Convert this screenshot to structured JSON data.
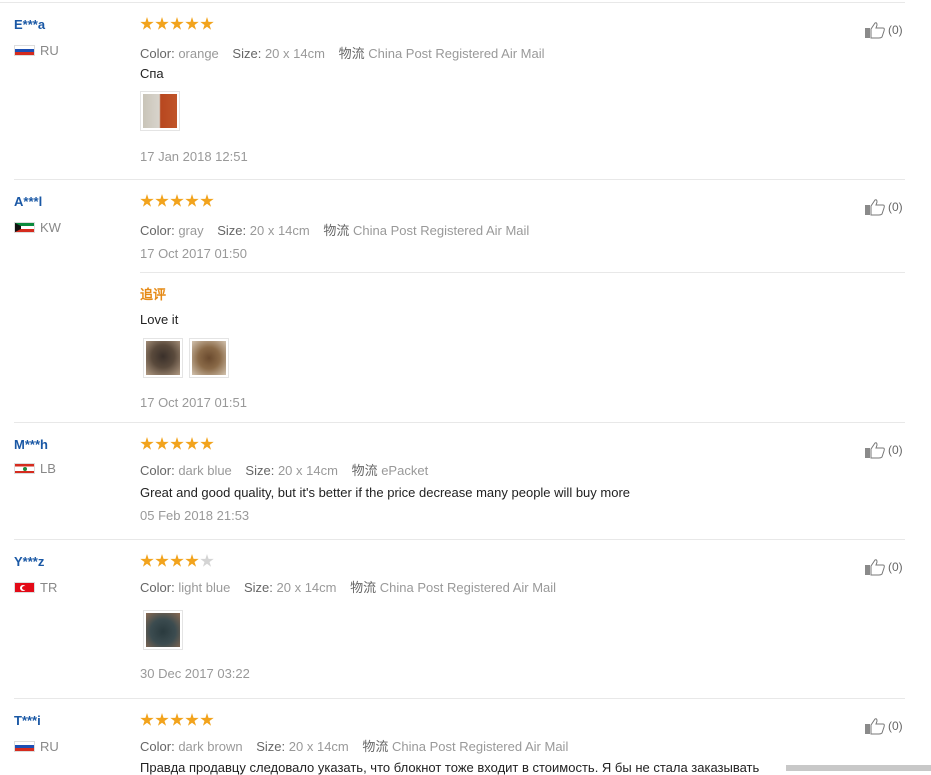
{
  "labels": {
    "color": "Color:",
    "size": "Size:",
    "shipping": "物流"
  },
  "reviews": [
    {
      "user": "E***a",
      "country": "RU",
      "rating": 5,
      "color": "orange",
      "size": "20 x 14cm",
      "shipping": "China Post Registered Air Mail",
      "text": "Спа",
      "images": [
        "photo-notebook-orange"
      ],
      "date": "17 Jan 2018 12:51",
      "likes": "(0)"
    },
    {
      "user": "A***l",
      "country": "KW",
      "rating": 5,
      "color": "gray",
      "size": "20 x 14cm",
      "shipping": "China Post Registered Air Mail",
      "text": "",
      "images": [],
      "date": "17 Oct 2017 01:50",
      "likes": "(0)",
      "followup": {
        "title": "追评",
        "text": "Love it",
        "images": [
          "photo-notebook-gray-1",
          "photo-notebook-gray-2"
        ],
        "date": "17 Oct 2017 01:51"
      }
    },
    {
      "user": "M***h",
      "country": "LB",
      "rating": 5,
      "color": "dark blue",
      "size": "20 x 14cm",
      "shipping": "ePacket",
      "text": "Great and good quality, but it's better if the price decrease many people will buy more",
      "images": [],
      "date": "05 Feb 2018 21:53",
      "likes": "(0)"
    },
    {
      "user": "Y***z",
      "country": "TR",
      "rating": 4,
      "color": "light blue",
      "size": "20 x 14cm",
      "shipping": "China Post Registered Air Mail",
      "text": "",
      "images": [
        "photo-notebook-lightblue"
      ],
      "date": "30 Dec 2017 03:22",
      "likes": "(0)"
    },
    {
      "user": "T***i",
      "country": "RU",
      "rating": 5,
      "color": "dark brown",
      "size": "20 x 14cm",
      "shipping": "China Post Registered Air Mail",
      "text": "Правда продавцу следовало указать, что блокнот тоже входит в стоимость. Я бы не стала заказывать",
      "images": [],
      "date": "",
      "likes": "(0)"
    }
  ],
  "icons": {
    "like": "thumbs-up-icon"
  },
  "colors": {
    "user": "#1a58a5",
    "star": "#f2a31c",
    "followup": "#e58a16"
  }
}
